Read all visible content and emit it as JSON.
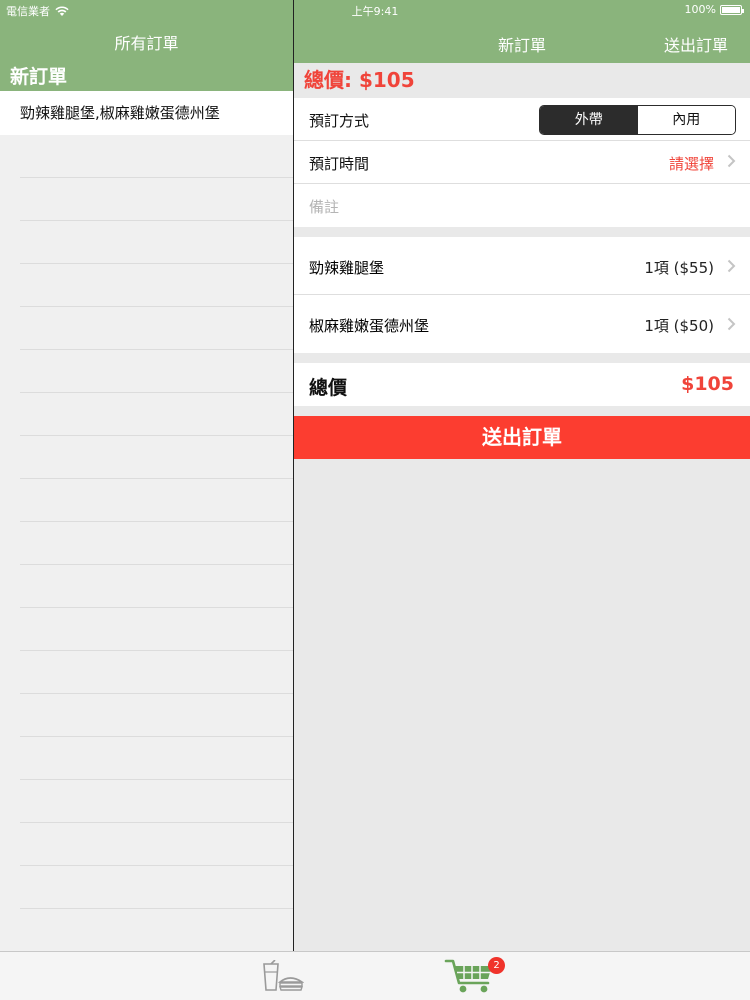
{
  "status_bar": {
    "carrier": "電信業者",
    "time": "上午9:41",
    "battery": "100%"
  },
  "nav": {
    "left_title": "所有訂單",
    "right_title": "新訂單",
    "right_action": "送出訂單"
  },
  "orders_list": {
    "section_title": "新訂單",
    "items": [
      {
        "label": "勁辣雞腿堡,椒麻雞嫩蛋德州堡"
      }
    ]
  },
  "order_detail": {
    "total_header": "總價: $105",
    "method": {
      "label": "預訂方式",
      "options": [
        "外帶",
        "內用"
      ],
      "selected": "外帶"
    },
    "time": {
      "label": "預訂時間",
      "value": "請選擇"
    },
    "note": {
      "placeholder": "備註"
    },
    "items": [
      {
        "name": "勁辣雞腿堡",
        "qty": "1項 ($55)"
      },
      {
        "name": "椒麻雞嫩蛋德州堡",
        "qty": "1項 ($50)"
      }
    ],
    "total_label": "總價",
    "total_amount": "$105",
    "submit_label": "送出訂單"
  },
  "tab_bar": {
    "tabs": [
      {
        "icon": "drink-burger-icon",
        "active": false
      },
      {
        "icon": "cart-icon",
        "active": true
      }
    ],
    "cart_badge": "2"
  },
  "colors": {
    "nav_green": "#8ab47c",
    "accent_red": "#f0443a",
    "button_red": "#fc3d30",
    "tab_active_green": "#6aa45a",
    "tab_inactive_gray": "#9a9a9a"
  }
}
